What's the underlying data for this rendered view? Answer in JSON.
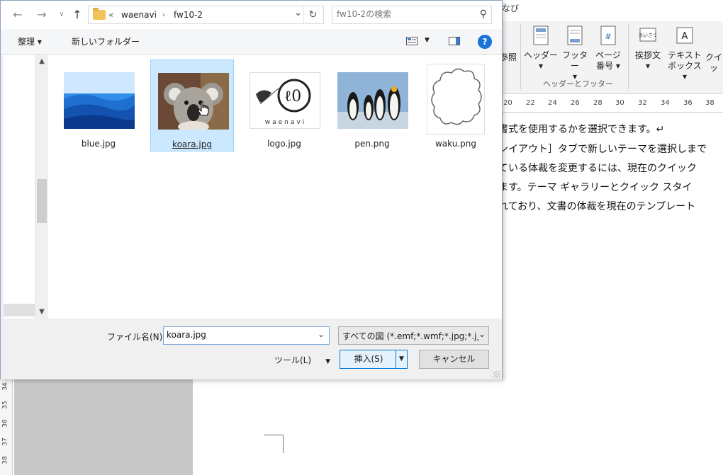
{
  "dialog": {
    "breadcrumb": [
      "waenavi",
      "fw10-2"
    ],
    "search_placeholder": "fw10-2の検索",
    "toolbar": {
      "organize": "整理 ▾",
      "new_folder": "新しいフォルダー"
    },
    "files": [
      {
        "name": "blue.jpg",
        "selected": false
      },
      {
        "name": "koara.jpg",
        "selected": true
      },
      {
        "name": "logo.jpg",
        "selected": false
      },
      {
        "name": "pen.png",
        "selected": false
      },
      {
        "name": "waku.png",
        "selected": false
      }
    ],
    "filename_label": "ファイル名(N):",
    "filename_value": "koara.jpg",
    "filetype_value": "すべての図 (*.emf;*.wmf;*.jpg;*.jp",
    "tools_label": "ツール(L)",
    "insert_label": "挿入(S)",
    "cancel_label": "キャンセル"
  },
  "word": {
    "title_fragment": "なび",
    "ribbon": {
      "ref_label": "参照",
      "header": "ヘッダー",
      "footer": "フッター",
      "page_number": [
        "ページ",
        "番号"
      ],
      "greeting": "挨拶文",
      "text_box": [
        "テキスト",
        "ボックス"
      ],
      "quick": "クイッ",
      "group_label": "ヘッダーとフッター"
    },
    "ruler_ticks": [
      "20",
      "22",
      "24",
      "26",
      "28",
      "30",
      "32",
      "34",
      "36",
      "38"
    ],
    "doc_lines": [
      "書式を使用するかを選択できます。↵",
      "ンイアウト］タブで新しいテーマを選択しまで",
      "ている体裁を変更するには、現在のクイック",
      "ます。テーマ ギャラリーとクイック スタイ",
      "れており、文書の体裁を現在のテンプレート"
    ],
    "vruler_ticks": [
      "34",
      "35",
      "36",
      "37",
      "38"
    ]
  }
}
